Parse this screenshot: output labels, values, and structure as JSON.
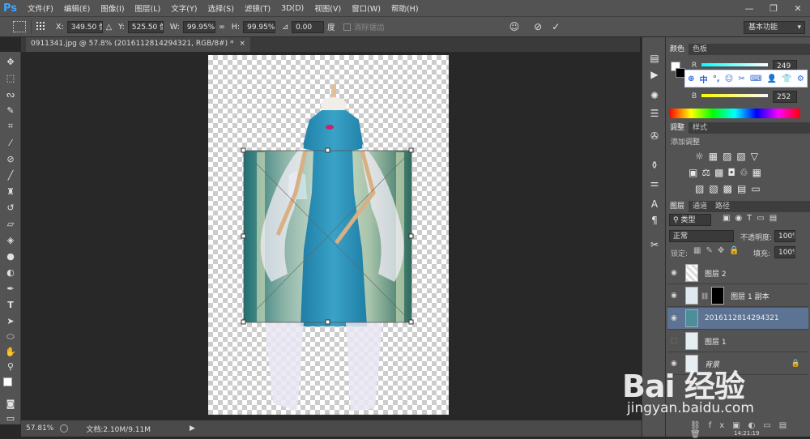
{
  "app": {
    "logo": "Ps"
  },
  "menu": [
    "文件(F)",
    "编辑(E)",
    "图像(I)",
    "图层(L)",
    "文字(Y)",
    "选择(S)",
    "滤镜(T)",
    "3D(D)",
    "视图(V)",
    "窗口(W)",
    "帮助(H)"
  ],
  "window_controls": {
    "minimize": "—",
    "restore": "❐",
    "close": "✕"
  },
  "options_bar": {
    "x_label": "X:",
    "x_value": "349.50 像素",
    "y_label": "Y:",
    "y_value": "525.50 像素",
    "w_label": "W:",
    "w_value": "99.95%",
    "h_label": "H:",
    "h_value": "99.95%",
    "angle_value": "0.00",
    "angle_unit": "度",
    "interp_label": "消除锯齿",
    "cancel_icon": "⃠",
    "commit_icon": "✓",
    "workspace": "基本功能"
  },
  "document_tab": {
    "title": "0911341.jpg @ 57.8% (2016112814294321, RGB/8#) *",
    "close": "×"
  },
  "status_bar": {
    "zoom": "57.81%",
    "doc_info": "文档:2.10M/9.11M"
  },
  "color_panel": {
    "tabs": [
      "颜色",
      "色板"
    ],
    "channels": [
      {
        "label": "R",
        "value": "249"
      },
      {
        "label": "B",
        "value": "252"
      }
    ]
  },
  "adjustments_panel": {
    "tabs": [
      "调整",
      "样式"
    ],
    "title": "添加调整"
  },
  "layers_panel": {
    "tabs": [
      "图层",
      "通道",
      "路径"
    ],
    "filter_label": "类型",
    "blend_mode": "正常",
    "opacity_label": "不透明度:",
    "opacity_value": "100%",
    "lock_label": "锁定:",
    "fill_label": "填充:",
    "fill_value": "100%",
    "layers": [
      {
        "name": "图层 2",
        "visible": true,
        "selected": false
      },
      {
        "name": "图层 1 副本",
        "visible": true,
        "selected": false
      },
      {
        "name": "2016112814294321",
        "visible": true,
        "selected": true
      },
      {
        "name": "图层 1",
        "visible": false,
        "selected": false
      },
      {
        "name": "背景",
        "visible": true,
        "selected": false
      }
    ]
  },
  "watermark": {
    "logo": "Bai 经验",
    "url": "jingyan.baidu.com"
  },
  "clock": "14:21:19",
  "colors": {
    "panel": "#535353",
    "selected_layer": "#5d7394",
    "dress": "#2f92b8",
    "ime_blue": "#2e67d8"
  }
}
